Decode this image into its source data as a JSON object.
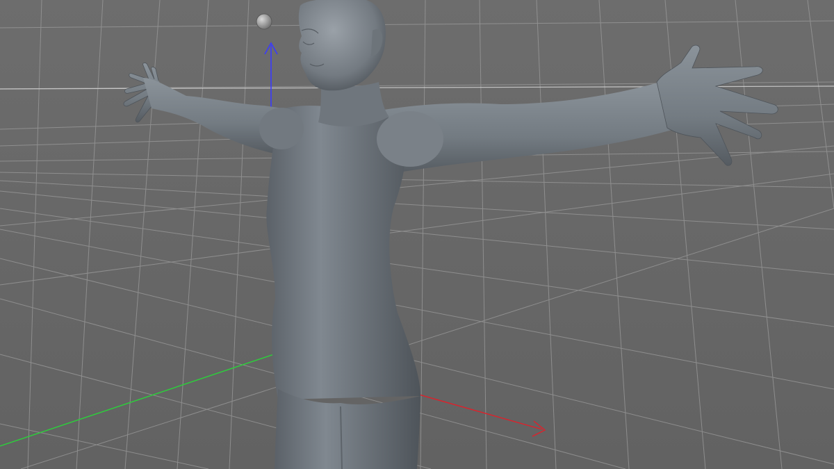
{
  "viewport": {
    "background": "#686868",
    "grid_color": "#a8a8a8",
    "horizon_color": "#d8d8d8"
  },
  "axes": {
    "x_color": "#e0202a",
    "y_color": "#3a3aff",
    "z_color": "#2bd23a"
  },
  "model": {
    "name": "humanoid-mesh",
    "pose": "T-pose",
    "shading": "smooth-gray",
    "base_color": "#7d848b"
  },
  "gizmo": {
    "light_icon": "sphere-light-icon"
  }
}
